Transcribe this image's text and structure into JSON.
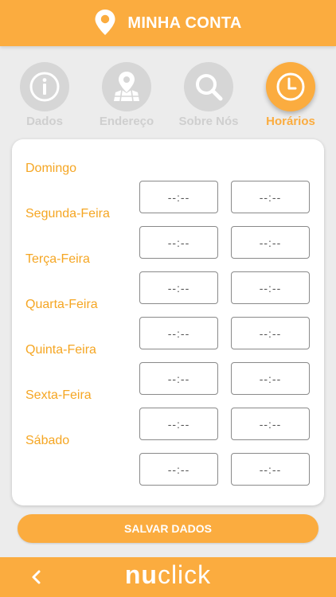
{
  "header": {
    "title": "MINHA CONTA",
    "icon": "location-pin-icon"
  },
  "tabs": [
    {
      "label": "Dados",
      "icon": "info-icon",
      "active": false
    },
    {
      "label": "Endereço",
      "icon": "map-pin-icon",
      "active": false
    },
    {
      "label": "Sobre Nós",
      "icon": "search-icon",
      "active": false
    },
    {
      "label": "Horários",
      "icon": "clock-icon",
      "active": true
    }
  ],
  "schedule": {
    "placeholder": "--:--",
    "days": [
      {
        "name": "Domingo",
        "open": "--:--",
        "close": "--:--"
      },
      {
        "name": "Segunda-Feira",
        "open": "--:--",
        "close": "--:--"
      },
      {
        "name": "Terça-Feira",
        "open": "--:--",
        "close": "--:--"
      },
      {
        "name": "Quarta-Feira",
        "open": "--:--",
        "close": "--:--"
      },
      {
        "name": "Quinta-Feira",
        "open": "--:--",
        "close": "--:--"
      },
      {
        "name": "Sexta-Feira",
        "open": "--:--",
        "close": "--:--"
      },
      {
        "name": "Sábado",
        "open": "--:--",
        "close": "--:--"
      }
    ]
  },
  "actions": {
    "save_label": "SALVAR DADOS"
  },
  "footer": {
    "back_icon": "chevron-left-icon",
    "logo_nu": "nu",
    "logo_click": "click"
  },
  "colors": {
    "brand": "#fbac3f",
    "day_text": "#f5a623",
    "inactive": "#d6d6d6"
  }
}
